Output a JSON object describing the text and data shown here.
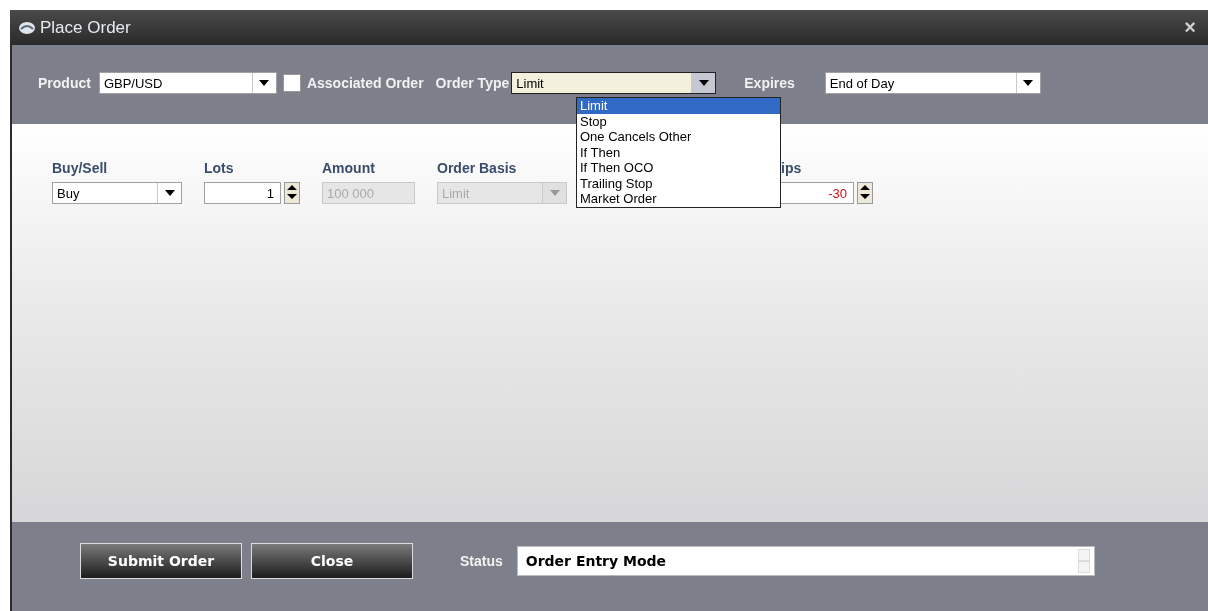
{
  "window": {
    "title": "Place Order",
    "close": "×"
  },
  "toolbar": {
    "product_label": "Product",
    "product": "GBP/USD",
    "associated": {
      "label": "Associated Order",
      "checked": false
    },
    "order_type_label": "Order Type",
    "order_type": "Limit",
    "expires_label": "Expires",
    "expires": "End of Day"
  },
  "order_type_menu": [
    {
      "label": "Limit",
      "selected": true
    },
    {
      "label": "Stop",
      "selected": false
    },
    {
      "label": "One Cancels Other",
      "selected": false
    },
    {
      "label": "If Then",
      "selected": false
    },
    {
      "label": "If Then OCO",
      "selected": false
    },
    {
      "label": "Trailing Stop",
      "selected": false
    },
    {
      "label": "Market Order",
      "selected": false
    }
  ],
  "fields": [
    {
      "kind": "select",
      "label": "Buy/Sell",
      "value": "Buy",
      "disabled": false
    },
    {
      "kind": "spin",
      "label": "Lots",
      "value": "1",
      "disabled": false
    },
    {
      "kind": "text",
      "label": "Amount",
      "value": "100 000",
      "disabled": true
    },
    {
      "kind": "select",
      "label": "Order Basis",
      "value": "Limit",
      "disabled": true
    },
    {
      "kind": "spin",
      "label": "ips",
      "value": "-30",
      "disabled": false,
      "negative": true
    }
  ],
  "footer": {
    "buttons": [
      "Submit Order",
      "Close"
    ],
    "status_label": "Status",
    "status": "Order Entry Mode"
  }
}
